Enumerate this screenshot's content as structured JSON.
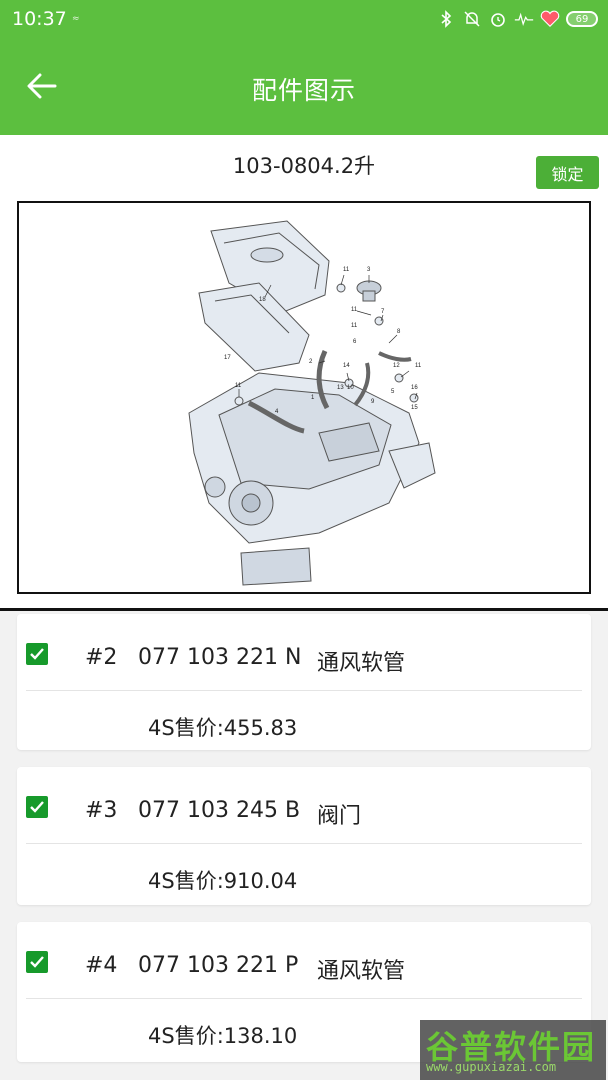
{
  "status_bar": {
    "time": "10:37",
    "small_indicator": "≈",
    "icons": [
      "bluetooth-icon",
      "alarm-off-icon",
      "alarm-icon",
      "activity-icon",
      "heart-icon"
    ],
    "battery": "69"
  },
  "app_bar": {
    "title": "配件图示",
    "back_icon": "arrow-left-icon"
  },
  "subheader": {
    "title": "103-0804.2升",
    "lock_label": "锁定"
  },
  "diagram": {
    "callouts": [
      "11",
      "3",
      "18",
      "11",
      "7",
      "11",
      "6",
      "8",
      "17",
      "2",
      "14",
      "12",
      "11",
      "13",
      "10",
      "9",
      "11",
      "16",
      "15",
      "1",
      "4",
      "5"
    ]
  },
  "parts": [
    {
      "num": "#2",
      "code": "077 103 221 N",
      "name": "通风软管",
      "price": "4S售价:455.83",
      "checked": true
    },
    {
      "num": "#3",
      "code": "077 103 245 B",
      "name": "阀门",
      "price": "4S售价:910.04",
      "checked": true
    },
    {
      "num": "#4",
      "code": "077 103 221 P",
      "name": "通风软管",
      "price": "4S售价:138.10",
      "checked": true
    }
  ],
  "watermark": {
    "main": "谷普软件园",
    "url": "www.gupuxiazai.com"
  },
  "colors": {
    "primary_green": "#5cbf3f",
    "button_green": "#4caf37",
    "checkbox_green": "#179a2b"
  }
}
